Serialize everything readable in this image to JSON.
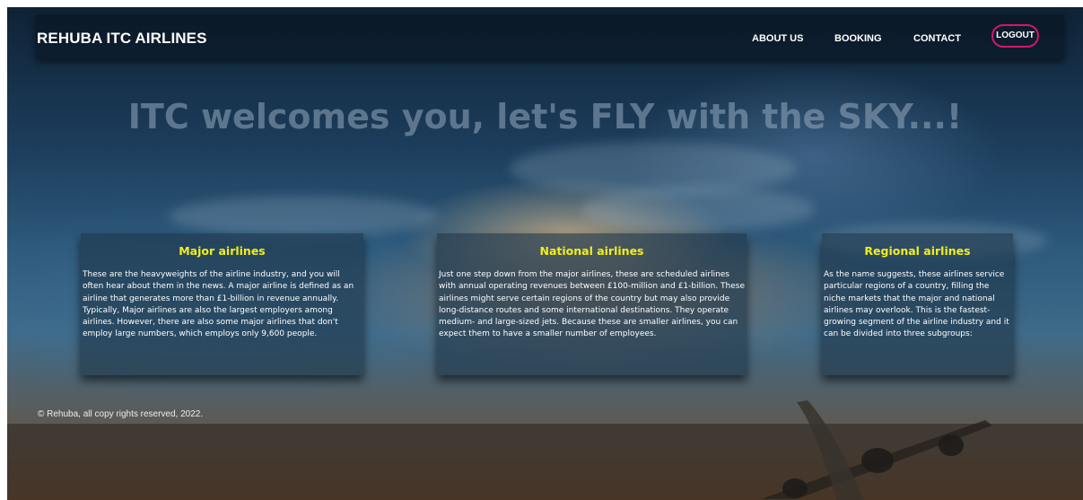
{
  "navbar": {
    "brand": "REHUBA ITC AIRLINES",
    "links": [
      "ABOUT US",
      "BOOKING",
      "CONTACT"
    ],
    "logout": "LOGOUT"
  },
  "hero": {
    "headline": "ITC welcomes you, let's FLY with the SKY...!"
  },
  "cards": [
    {
      "title": "Major airlines",
      "body": "These are the heavyweights of the airline industry, and you will often hear about them in the news. A major airline is defined as an airline that generates more than £1-billion in revenue annually. Typically, Major airlines are also the largest employers among airlines. However, there are also some major airlines that don't employ large numbers, which employs only 9,600 people."
    },
    {
      "title": "National airlines",
      "body": "Just one step down from the major airlines, these are scheduled airlines with annual operating revenues between £100-million and £1-billion. These airlines might serve certain regions of the country but may also provide long-distance routes and some international destinations. They operate medium- and large-sized jets. Because these are smaller airlines, you can expect them to have a smaller number of employees."
    },
    {
      "title": "Regional airlines",
      "body": "As the name suggests, these airlines service particular regions of a country, filling the niche markets that the major and national airlines may overlook. This is the fastest-growing segment of the airline industry and it can be divided into three subgroups:"
    }
  ],
  "footer": {
    "copyright": "© Rehuba, all copy rights reserved, 2022."
  },
  "colors": {
    "card_title": "#f2ee1c",
    "logout_border": "#d0186c",
    "hero_text": "#96aabe"
  }
}
